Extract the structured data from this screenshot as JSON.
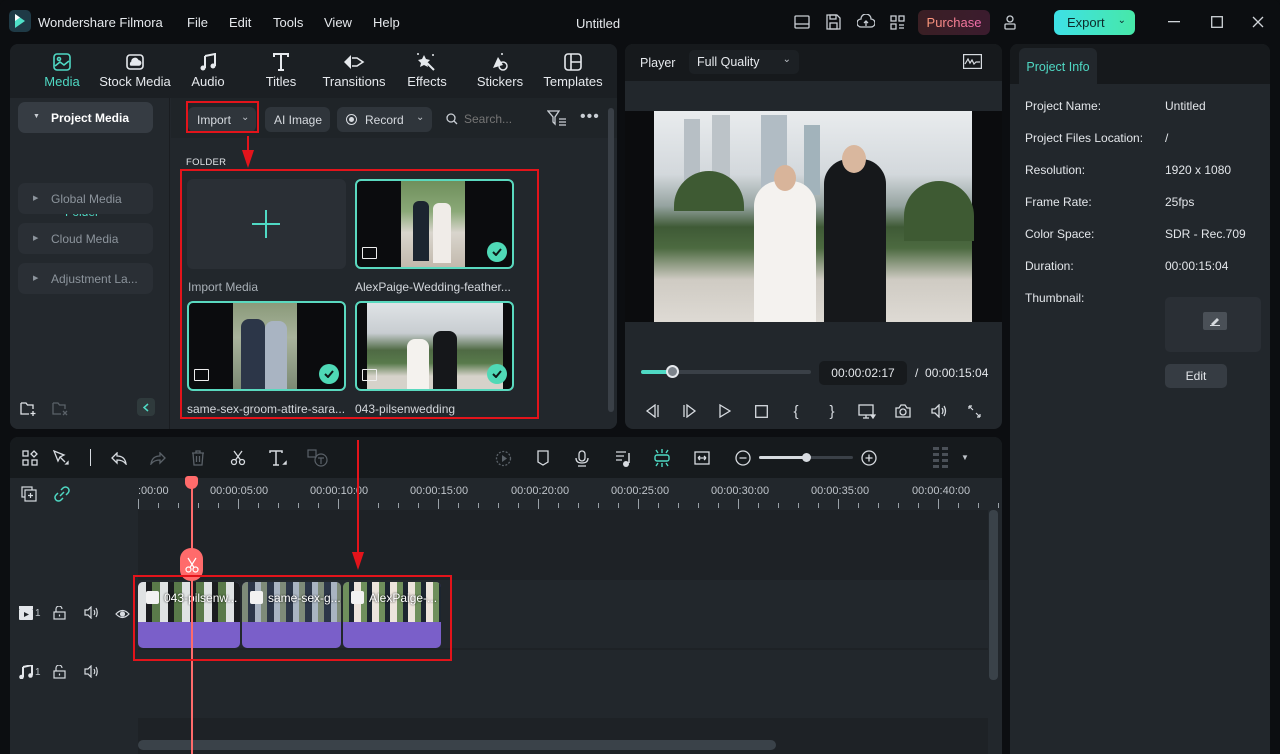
{
  "window": {
    "app_name": "Wondershare Filmora",
    "document_title": "Untitled",
    "menu": [
      "File",
      "Edit",
      "Tools",
      "View",
      "Help"
    ],
    "purchase_label": "Purchase",
    "export_label": "Export",
    "colors": {
      "accent": "#4fd9c4",
      "annotation_red": "#e3141b",
      "clip_purple": "#7a5fc9",
      "playhead": "#ff6b6b"
    }
  },
  "media_tabs": [
    {
      "label": "Media",
      "icon": "media-icon",
      "active": true
    },
    {
      "label": "Stock Media",
      "icon": "stock-media-icon"
    },
    {
      "label": "Audio",
      "icon": "music-note-icon"
    },
    {
      "label": "Titles",
      "icon": "title-t-icon"
    },
    {
      "label": "Transitions",
      "icon": "transitions-icon"
    },
    {
      "label": "Effects",
      "icon": "effects-wand-icon"
    },
    {
      "label": "Stickers",
      "icon": "stickers-icon"
    },
    {
      "label": "Templates",
      "icon": "templates-icon"
    }
  ],
  "sidebar": {
    "project_media": "Project Media",
    "folder": "Folder",
    "items": [
      "Global Media",
      "Cloud Media",
      "Adjustment La..."
    ]
  },
  "media_toolbar": {
    "import_label": "Import",
    "ai_image_label": "AI Image",
    "record_label": "Record",
    "search_placeholder": "Search..."
  },
  "media_grid": {
    "section_header": "FOLDER",
    "import_media_label": "Import Media",
    "items": [
      {
        "name": "AlexPaige-Wedding-feather...",
        "selected": true
      },
      {
        "name": "same-sex-groom-attire-sara...",
        "selected": true
      },
      {
        "name": "043-pilsenwedding",
        "selected": true
      }
    ]
  },
  "player": {
    "label": "Player",
    "quality": "Full Quality",
    "current_time": "00:00:02:17",
    "separator": "/",
    "total_time": "00:00:15:04",
    "progress_fraction": 0.18
  },
  "project_info": {
    "tab_label": "Project Info",
    "rows": [
      {
        "key": "Project Name:",
        "value": "Untitled"
      },
      {
        "key": "Project Files Location:",
        "value": "/"
      },
      {
        "key": "Resolution:",
        "value": "1920 x 1080"
      },
      {
        "key": "Frame Rate:",
        "value": "25fps"
      },
      {
        "key": "Color Space:",
        "value": "SDR - Rec.709"
      },
      {
        "key": "Duration:",
        "value": "00:00:15:04"
      }
    ],
    "thumbnail_label": "Thumbnail:",
    "edit_label": "Edit"
  },
  "timeline": {
    "ruler_labels": [
      ":00:00",
      "00:00:05:00",
      "00:00:10:00",
      "00:00:15:00",
      "00:00:20:00",
      "00:00:25:00",
      "00:00:30:00",
      "00:00:35:00",
      "00:00:40:00"
    ],
    "zoom_fraction": 0.5,
    "video_track_number": "1",
    "audio_track_number": "1",
    "clips": [
      {
        "name": "043-pilsenw..."
      },
      {
        "name": "same-sex-g..."
      },
      {
        "name": "AlexPaige-..."
      }
    ]
  }
}
